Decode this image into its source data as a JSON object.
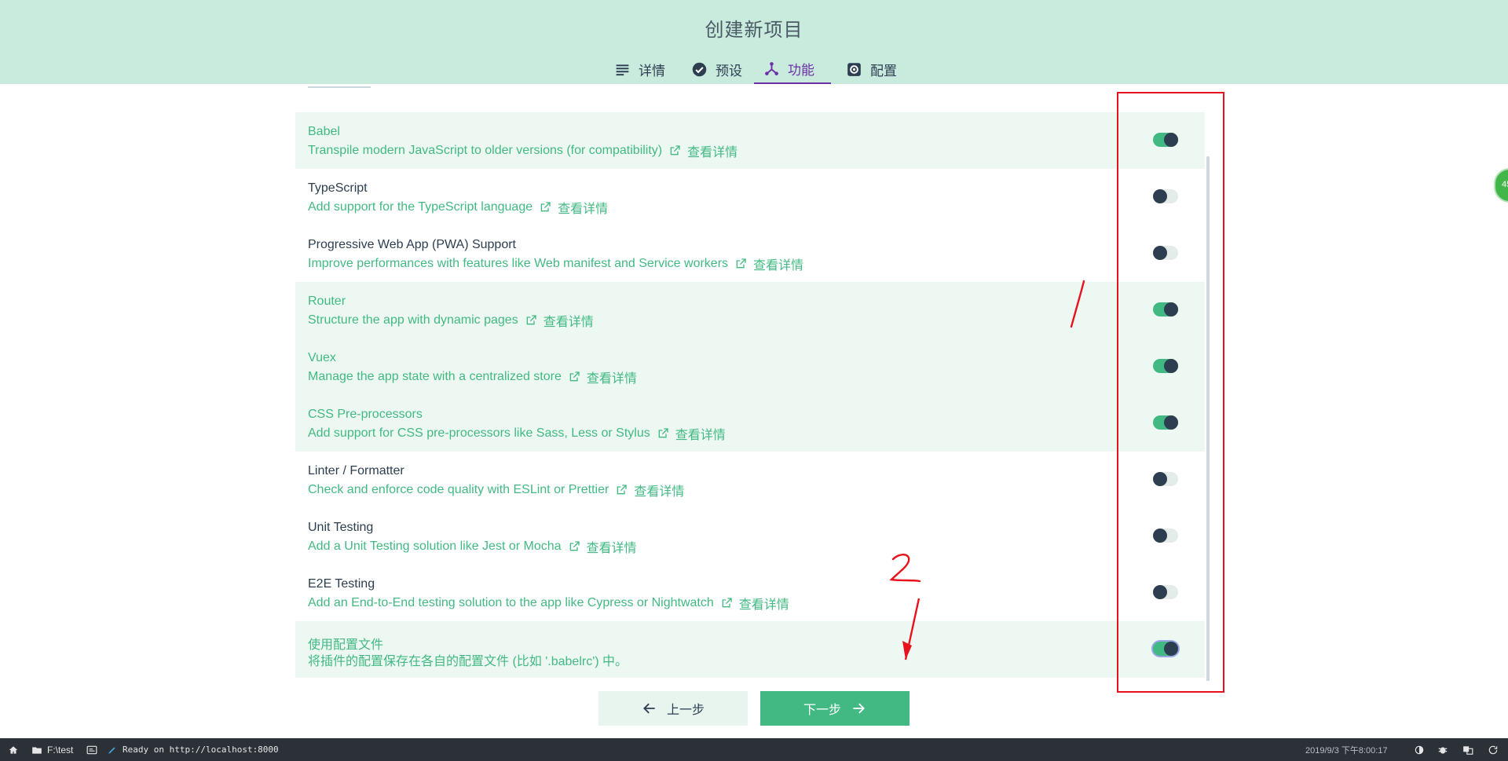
{
  "header": {
    "title": "创建新项目"
  },
  "tabs": [
    {
      "label": "详情",
      "icon": "list-icon"
    },
    {
      "label": "预设",
      "icon": "check-circle-icon"
    },
    {
      "label": "功能",
      "icon": "features-icon",
      "active": true
    },
    {
      "label": "配置",
      "icon": "gear-icon"
    }
  ],
  "features": [
    {
      "name": "Babel",
      "desc": "Transpile modern JavaScript to older versions (for compatibility)",
      "link": "查看详情",
      "enabled": true
    },
    {
      "name": "TypeScript",
      "desc": "Add support for the TypeScript language",
      "link": "查看详情",
      "enabled": false
    },
    {
      "name": "Progressive Web App (PWA) Support",
      "desc": "Improve performances with features like Web manifest and Service workers",
      "link": "查看详情",
      "enabled": false
    },
    {
      "name": "Router",
      "desc": "Structure the app with dynamic pages",
      "link": "查看详情",
      "enabled": true
    },
    {
      "name": "Vuex",
      "desc": "Manage the app state with a centralized store",
      "link": "查看详情",
      "enabled": true
    },
    {
      "name": "CSS Pre-processors",
      "desc": "Add support for CSS pre-processors like Sass, Less or Stylus",
      "link": "查看详情",
      "enabled": true
    },
    {
      "name": "Linter / Formatter",
      "desc": "Check and enforce code quality with ESLint or Prettier",
      "link": "查看详情",
      "enabled": false
    },
    {
      "name": "Unit Testing",
      "desc": "Add a Unit Testing solution like Jest or Mocha",
      "link": "查看详情",
      "enabled": false
    },
    {
      "name": "E2E Testing",
      "desc": "Add an End-to-End testing solution to the app like Cypress or Nightwatch",
      "link": "查看详情",
      "enabled": false
    },
    {
      "name": "使用配置文件",
      "desc": "将插件的配置保存在各自的配置文件 (比如 '.babelrc') 中。",
      "link": "",
      "enabled": true
    }
  ],
  "buttons": {
    "prev": "上一步",
    "next": "下一步"
  },
  "annotations": {
    "mark1": "1",
    "mark2": "2"
  },
  "badge": {
    "text": "45"
  },
  "statusbar": {
    "folder": "F:\\test",
    "message": "Ready on http://localhost:8000",
    "time": "2019/9/3 下午8:00:17"
  },
  "colors": {
    "accent": "#42b983",
    "header_bg": "#c8ebde",
    "active_tab": "#6d2fa8",
    "annotation": "#e8121c"
  }
}
